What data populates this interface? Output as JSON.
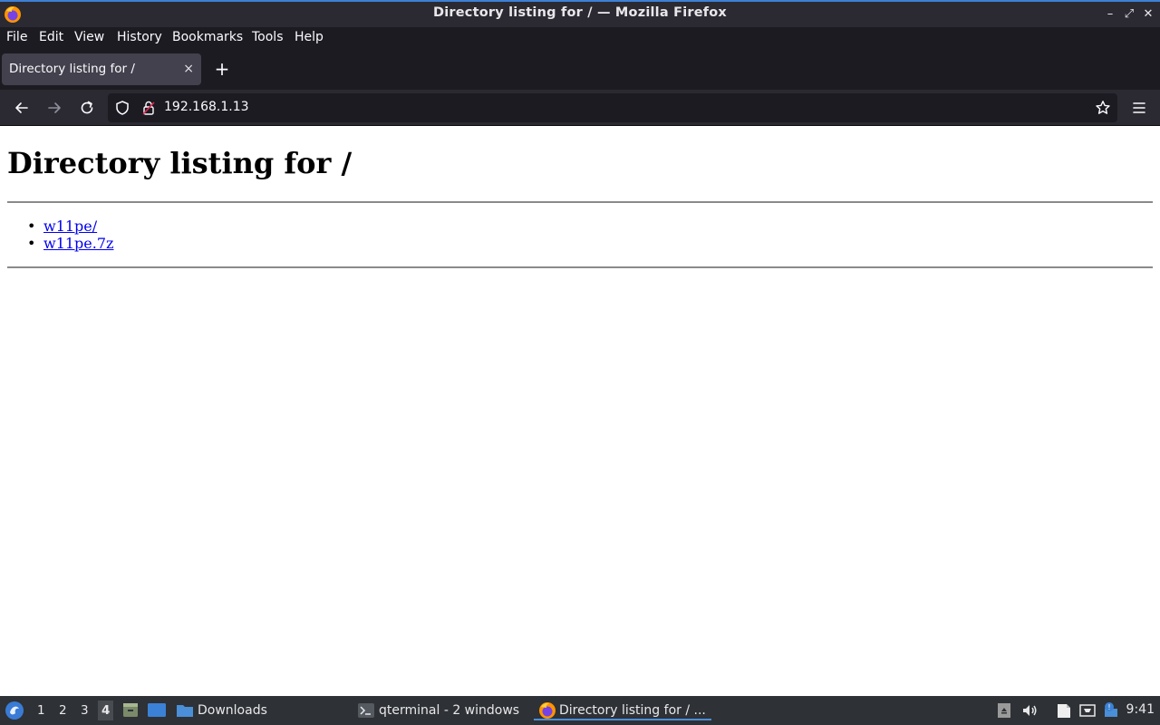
{
  "window": {
    "title": "Directory listing for / — Mozilla Firefox",
    "controls": [
      "–",
      "⤢",
      "✕"
    ]
  },
  "menubar": {
    "items": [
      "File",
      "Edit",
      "View",
      "History",
      "Bookmarks",
      "Tools",
      "Help"
    ]
  },
  "tabs": [
    {
      "title": "Directory listing for /",
      "close": "×"
    }
  ],
  "newtab_label": "+",
  "navbar": {
    "url": "192.168.1.13"
  },
  "page": {
    "heading": "Directory listing for /",
    "entries": [
      "w11pe/",
      "w11pe.7z"
    ]
  },
  "taskbar": {
    "workspaces": [
      "1",
      "2",
      "3",
      "4"
    ],
    "active_workspace": "4",
    "items": [
      {
        "label": "Downloads"
      },
      {
        "label": "qterminal - 2 windows"
      },
      {
        "label": "Directory listing for / ..."
      }
    ],
    "clock": "9:41"
  },
  "colors": {
    "accent": "#3d7fd6",
    "link": "#0000ee",
    "chrome_dark": "#1c1b22",
    "chrome": "#2b2a33"
  }
}
